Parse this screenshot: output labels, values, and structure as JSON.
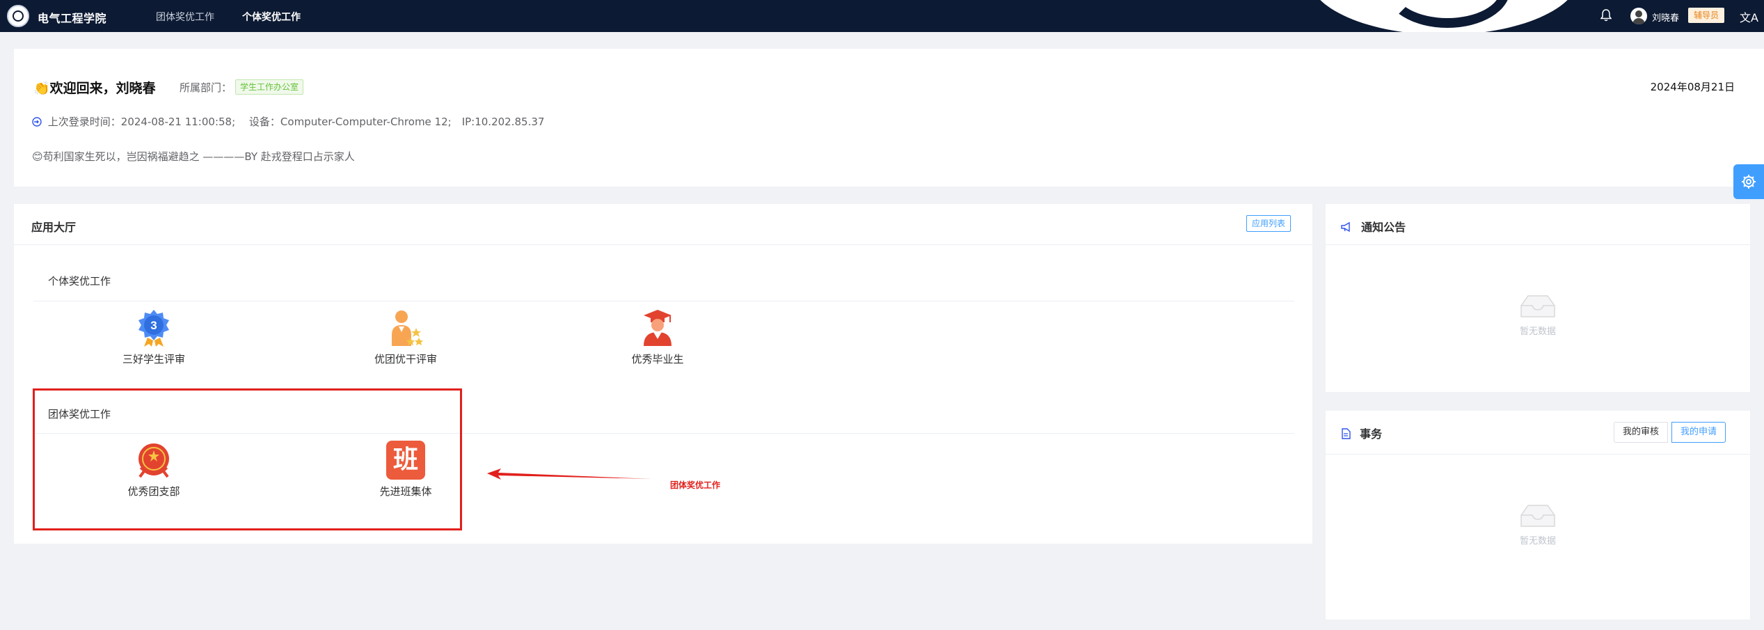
{
  "header": {
    "site_title": "电气工程学院",
    "nav": [
      "团体奖优工作",
      "个体奖优工作"
    ],
    "user_name": "刘晓春",
    "role": "辅导员",
    "translate_icon": "文A"
  },
  "welcome": {
    "emoji": "👏",
    "title": "欢迎回来，刘晓春",
    "dept_label": "所属部门：",
    "dept_tag": "学生工作办公室",
    "date": "2024年08月21日",
    "login_icon": "login-icon",
    "login_text": "上次登录时间：2024-08-21 11:00:58;　 设备：Computer-Computer-Chrome 12;　IP:10.202.85.37",
    "motto": "😊苟利国家生死以，岂因祸福避趋之 ————BY 赴戎登程口占示家人"
  },
  "hall": {
    "title": "应用大厅",
    "list_button": "应用列表",
    "sections": [
      {
        "title": "个体奖优工作",
        "apps": [
          {
            "label": "三好学生评审",
            "icon": "medal-icon"
          },
          {
            "label": "优团优干评审",
            "icon": "person-stars-icon"
          },
          {
            "label": "优秀毕业生",
            "icon": "graduate-icon"
          }
        ]
      },
      {
        "title": "团体奖优工作",
        "apps": [
          {
            "label": "优秀团支部",
            "icon": "league-emblem-icon"
          },
          {
            "label": "先进班集体",
            "icon": "class-icon",
            "glyph": "班"
          }
        ]
      }
    ]
  },
  "annotation": {
    "text": "团体奖优工作",
    "color": "#e1201c"
  },
  "notice": {
    "title": "通知公告",
    "empty_text": "暂无数据"
  },
  "affairs": {
    "title": "事务",
    "tabs": [
      "我的审核",
      "我的申请"
    ],
    "active_tab": "我的申请",
    "empty_text": "暂无数据"
  },
  "colors": {
    "topbar": "#0c1a33",
    "accent": "#409eff",
    "tag_green": "#67c23a",
    "highlight_red": "#e1201c"
  }
}
